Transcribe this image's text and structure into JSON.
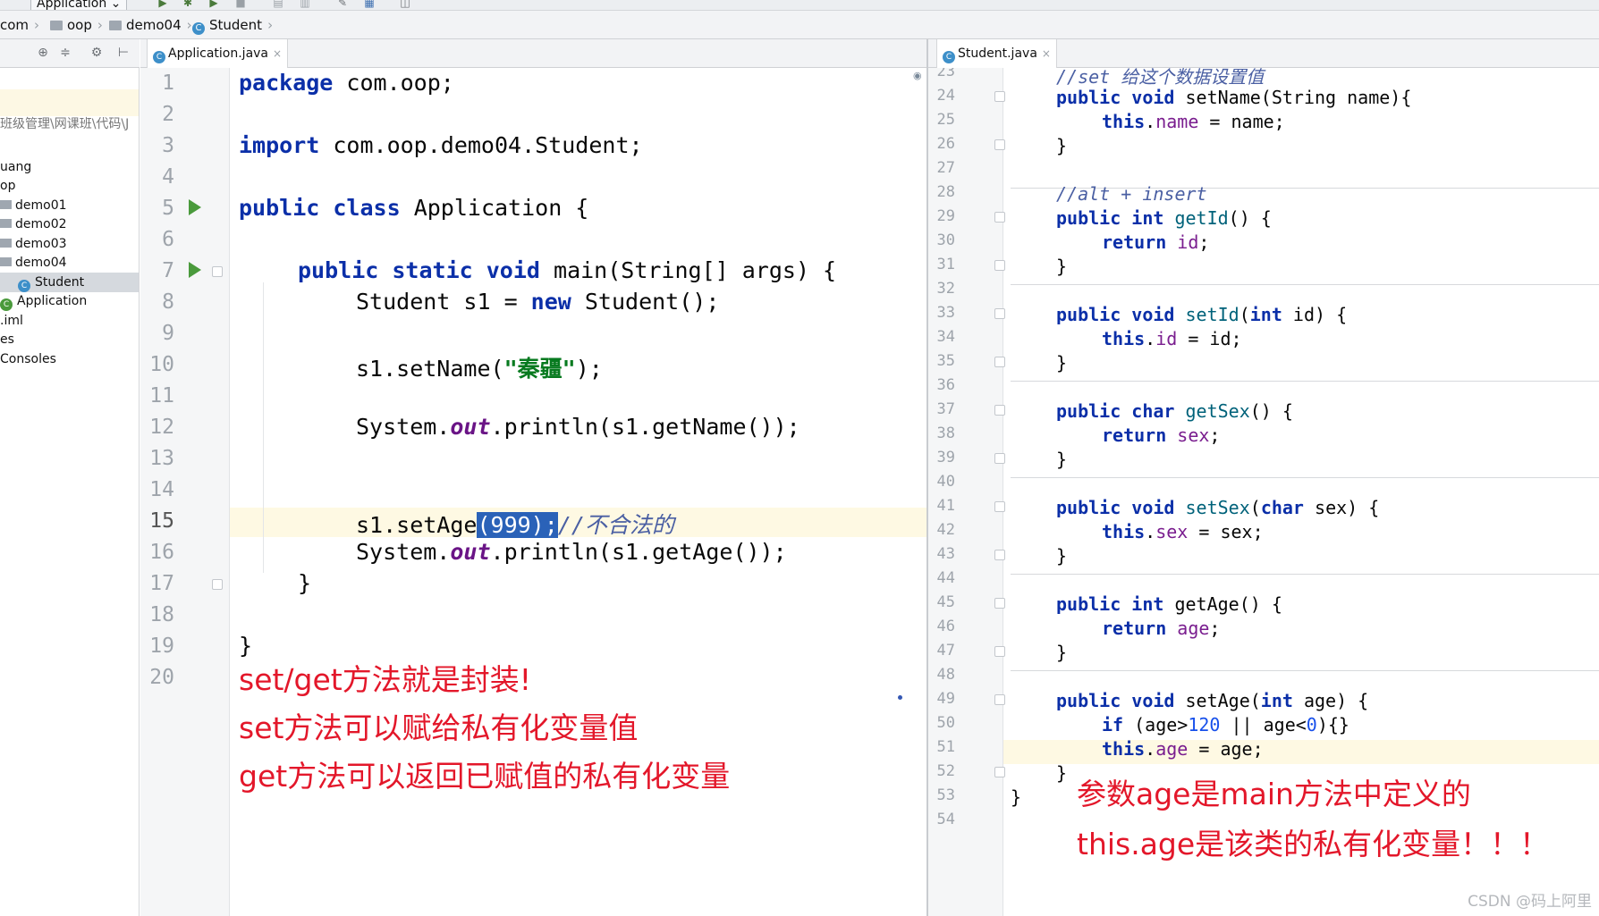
{
  "toolbar": {
    "run_config": "Application"
  },
  "breadcrumb": [
    "com",
    "oop",
    "demo04",
    "Student"
  ],
  "project": {
    "path": "班级管理\\网课班\\代码\\J",
    "items": [
      {
        "label": "uang",
        "type": "text"
      },
      {
        "label": "op",
        "type": "text"
      },
      {
        "label": "demo01",
        "type": "folder"
      },
      {
        "label": "demo02",
        "type": "folder"
      },
      {
        "label": "demo03",
        "type": "folder"
      },
      {
        "label": "demo04",
        "type": "folder"
      },
      {
        "label": "Student",
        "type": "class",
        "selected": true
      },
      {
        "label": "Application",
        "type": "class"
      },
      {
        "label": ".iml",
        "type": "text"
      },
      {
        "label": "es",
        "type": "text"
      },
      {
        "label": "Consoles",
        "type": "text"
      }
    ]
  },
  "left_editor": {
    "tab": "Application.java",
    "line_numbers": [
      "1",
      "2",
      "3",
      "4",
      "5",
      "6",
      "7",
      "8",
      "9",
      "10",
      "11",
      "12",
      "13",
      "14",
      "15",
      "16",
      "17",
      "18",
      "19",
      "20"
    ],
    "code": {
      "l1_kw": "package",
      "l1_rest": " com.oop;",
      "l3_kw": "import",
      "l3_rest": " com.oop.demo04.Student;",
      "l5_kw1": "public",
      "l5_kw2": "class",
      "l5_rest": " Application {",
      "l7_kw1": "public",
      "l7_kw2": "static",
      "l7_kw3": "void",
      "l7_rest": " main(String[] args) {",
      "l8_a": "Student s1 = ",
      "l8_kw": "new",
      "l8_b": " Student();",
      "l10_a": "s1.setName(",
      "l10_str": "\"秦疆\"",
      "l10_b": ");",
      "l12_a": "System.",
      "l12_out": "out",
      "l12_b": ".println(s1.getName());",
      "l15_a": "s1.setAge",
      "l15_sel": "(999);",
      "l15_cmt": "//不合法的",
      "l16_a": "System.",
      "l16_out": "out",
      "l16_b": ".println(s1.getAge());",
      "l17": "}",
      "l19": "}"
    },
    "annotations": [
      "set/get方法就是封装!",
      "set方法可以赋给私有化变量值",
      "get方法可以返回已赋值的私有化变量"
    ]
  },
  "right_editor": {
    "tab": "Student.java",
    "line_numbers": [
      "23",
      "24",
      "25",
      "26",
      "27",
      "28",
      "29",
      "30",
      "31",
      "32",
      "33",
      "34",
      "35",
      "36",
      "37",
      "38",
      "39",
      "40",
      "41",
      "42",
      "43",
      "44",
      "45",
      "46",
      "47",
      "48",
      "49",
      "50",
      "51",
      "52",
      "53",
      "54"
    ],
    "code": {
      "l23": "//set 给这个数据设置值",
      "l24_kw1": "public",
      "l24_kw2": "void",
      "l24_rest": " setName(String name){",
      "l25_kw": "this",
      "l25_fld": "name",
      "l25_rest": " = name;",
      "l26": "}",
      "l28": "//alt + insert",
      "l29_kw1": "public",
      "l29_kw2": "int",
      "l29_mth": " getId",
      "l29_rest": "() {",
      "l30_kw": "return",
      "l30_fld": " id",
      "l30_rest": ";",
      "l31": "}",
      "l33_kw1": "public",
      "l33_kw2": "void",
      "l33_mth": " setId",
      "l33_p1": "(",
      "l33_kw3": "int",
      "l33_rest": " id) {",
      "l34_kw": "this",
      "l34_fld": "id",
      "l34_rest": " = id;",
      "l35": "}",
      "l37_kw1": "public",
      "l37_kw2": "char",
      "l37_mth": " getSex",
      "l37_rest": "() {",
      "l38_kw": "return",
      "l38_fld": " sex",
      "l38_rest": ";",
      "l39": "}",
      "l41_kw1": "public",
      "l41_kw2": "void",
      "l41_mth": " setSex",
      "l41_p1": "(",
      "l41_kw3": "char",
      "l41_rest": " sex) {",
      "l42_kw": "this",
      "l42_fld": "sex",
      "l42_rest": " = sex;",
      "l43": "}",
      "l45_kw1": "public",
      "l45_kw2": "int",
      "l45_rest": " getAge() {",
      "l46_kw": "return",
      "l46_fld": " age",
      "l46_rest": ";",
      "l47": "}",
      "l49_kw1": "public",
      "l49_kw2": "void",
      "l49_p1": " setAge(",
      "l49_kw3": "int",
      "l49_rest": " age) {",
      "l50_kw": "if",
      "l50_a": " (age>",
      "l50_n1": "120",
      "l50_b": " || age<",
      "l50_n2": "0",
      "l50_c": "){}",
      "l51_kw": "this",
      "l51_fld": "age",
      "l51_rest": " = age;",
      "l52": "}",
      "l53": "}"
    },
    "annotations": [
      "参数age是main方法中定义的",
      "this.age是该类的私有化变量！！！"
    ]
  },
  "watermark": "CSDN @码上阿里"
}
